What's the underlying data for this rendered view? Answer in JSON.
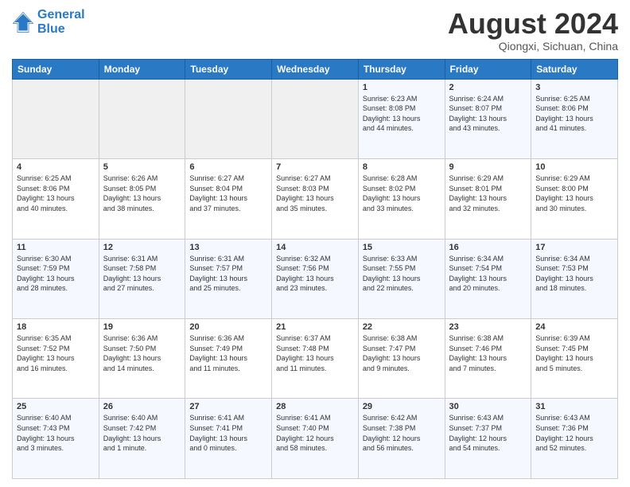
{
  "header": {
    "logo_line1": "General",
    "logo_line2": "Blue",
    "month": "August 2024",
    "location": "Qiongxi, Sichuan, China"
  },
  "weekdays": [
    "Sunday",
    "Monday",
    "Tuesday",
    "Wednesday",
    "Thursday",
    "Friday",
    "Saturday"
  ],
  "weeks": [
    [
      {
        "day": "",
        "text": ""
      },
      {
        "day": "",
        "text": ""
      },
      {
        "day": "",
        "text": ""
      },
      {
        "day": "",
        "text": ""
      },
      {
        "day": "1",
        "text": "Sunrise: 6:23 AM\nSunset: 8:08 PM\nDaylight: 13 hours\nand 44 minutes."
      },
      {
        "day": "2",
        "text": "Sunrise: 6:24 AM\nSunset: 8:07 PM\nDaylight: 13 hours\nand 43 minutes."
      },
      {
        "day": "3",
        "text": "Sunrise: 6:25 AM\nSunset: 8:06 PM\nDaylight: 13 hours\nand 41 minutes."
      }
    ],
    [
      {
        "day": "4",
        "text": "Sunrise: 6:25 AM\nSunset: 8:06 PM\nDaylight: 13 hours\nand 40 minutes."
      },
      {
        "day": "5",
        "text": "Sunrise: 6:26 AM\nSunset: 8:05 PM\nDaylight: 13 hours\nand 38 minutes."
      },
      {
        "day": "6",
        "text": "Sunrise: 6:27 AM\nSunset: 8:04 PM\nDaylight: 13 hours\nand 37 minutes."
      },
      {
        "day": "7",
        "text": "Sunrise: 6:27 AM\nSunset: 8:03 PM\nDaylight: 13 hours\nand 35 minutes."
      },
      {
        "day": "8",
        "text": "Sunrise: 6:28 AM\nSunset: 8:02 PM\nDaylight: 13 hours\nand 33 minutes."
      },
      {
        "day": "9",
        "text": "Sunrise: 6:29 AM\nSunset: 8:01 PM\nDaylight: 13 hours\nand 32 minutes."
      },
      {
        "day": "10",
        "text": "Sunrise: 6:29 AM\nSunset: 8:00 PM\nDaylight: 13 hours\nand 30 minutes."
      }
    ],
    [
      {
        "day": "11",
        "text": "Sunrise: 6:30 AM\nSunset: 7:59 PM\nDaylight: 13 hours\nand 28 minutes."
      },
      {
        "day": "12",
        "text": "Sunrise: 6:31 AM\nSunset: 7:58 PM\nDaylight: 13 hours\nand 27 minutes."
      },
      {
        "day": "13",
        "text": "Sunrise: 6:31 AM\nSunset: 7:57 PM\nDaylight: 13 hours\nand 25 minutes."
      },
      {
        "day": "14",
        "text": "Sunrise: 6:32 AM\nSunset: 7:56 PM\nDaylight: 13 hours\nand 23 minutes."
      },
      {
        "day": "15",
        "text": "Sunrise: 6:33 AM\nSunset: 7:55 PM\nDaylight: 13 hours\nand 22 minutes."
      },
      {
        "day": "16",
        "text": "Sunrise: 6:34 AM\nSunset: 7:54 PM\nDaylight: 13 hours\nand 20 minutes."
      },
      {
        "day": "17",
        "text": "Sunrise: 6:34 AM\nSunset: 7:53 PM\nDaylight: 13 hours\nand 18 minutes."
      }
    ],
    [
      {
        "day": "18",
        "text": "Sunrise: 6:35 AM\nSunset: 7:52 PM\nDaylight: 13 hours\nand 16 minutes."
      },
      {
        "day": "19",
        "text": "Sunrise: 6:36 AM\nSunset: 7:50 PM\nDaylight: 13 hours\nand 14 minutes."
      },
      {
        "day": "20",
        "text": "Sunrise: 6:36 AM\nSunset: 7:49 PM\nDaylight: 13 hours\nand 11 minutes."
      },
      {
        "day": "21",
        "text": "Sunrise: 6:37 AM\nSunset: 7:48 PM\nDaylight: 13 hours\nand 11 minutes."
      },
      {
        "day": "22",
        "text": "Sunrise: 6:38 AM\nSunset: 7:47 PM\nDaylight: 13 hours\nand 9 minutes."
      },
      {
        "day": "23",
        "text": "Sunrise: 6:38 AM\nSunset: 7:46 PM\nDaylight: 13 hours\nand 7 minutes."
      },
      {
        "day": "24",
        "text": "Sunrise: 6:39 AM\nSunset: 7:45 PM\nDaylight: 13 hours\nand 5 minutes."
      }
    ],
    [
      {
        "day": "25",
        "text": "Sunrise: 6:40 AM\nSunset: 7:43 PM\nDaylight: 13 hours\nand 3 minutes."
      },
      {
        "day": "26",
        "text": "Sunrise: 6:40 AM\nSunset: 7:42 PM\nDaylight: 13 hours\nand 1 minute."
      },
      {
        "day": "27",
        "text": "Sunrise: 6:41 AM\nSunset: 7:41 PM\nDaylight: 13 hours\nand 0 minutes."
      },
      {
        "day": "28",
        "text": "Sunrise: 6:41 AM\nSunset: 7:40 PM\nDaylight: 12 hours\nand 58 minutes."
      },
      {
        "day": "29",
        "text": "Sunrise: 6:42 AM\nSunset: 7:38 PM\nDaylight: 12 hours\nand 56 minutes."
      },
      {
        "day": "30",
        "text": "Sunrise: 6:43 AM\nSunset: 7:37 PM\nDaylight: 12 hours\nand 54 minutes."
      },
      {
        "day": "31",
        "text": "Sunrise: 6:43 AM\nSunset: 7:36 PM\nDaylight: 12 hours\nand 52 minutes."
      }
    ]
  ]
}
